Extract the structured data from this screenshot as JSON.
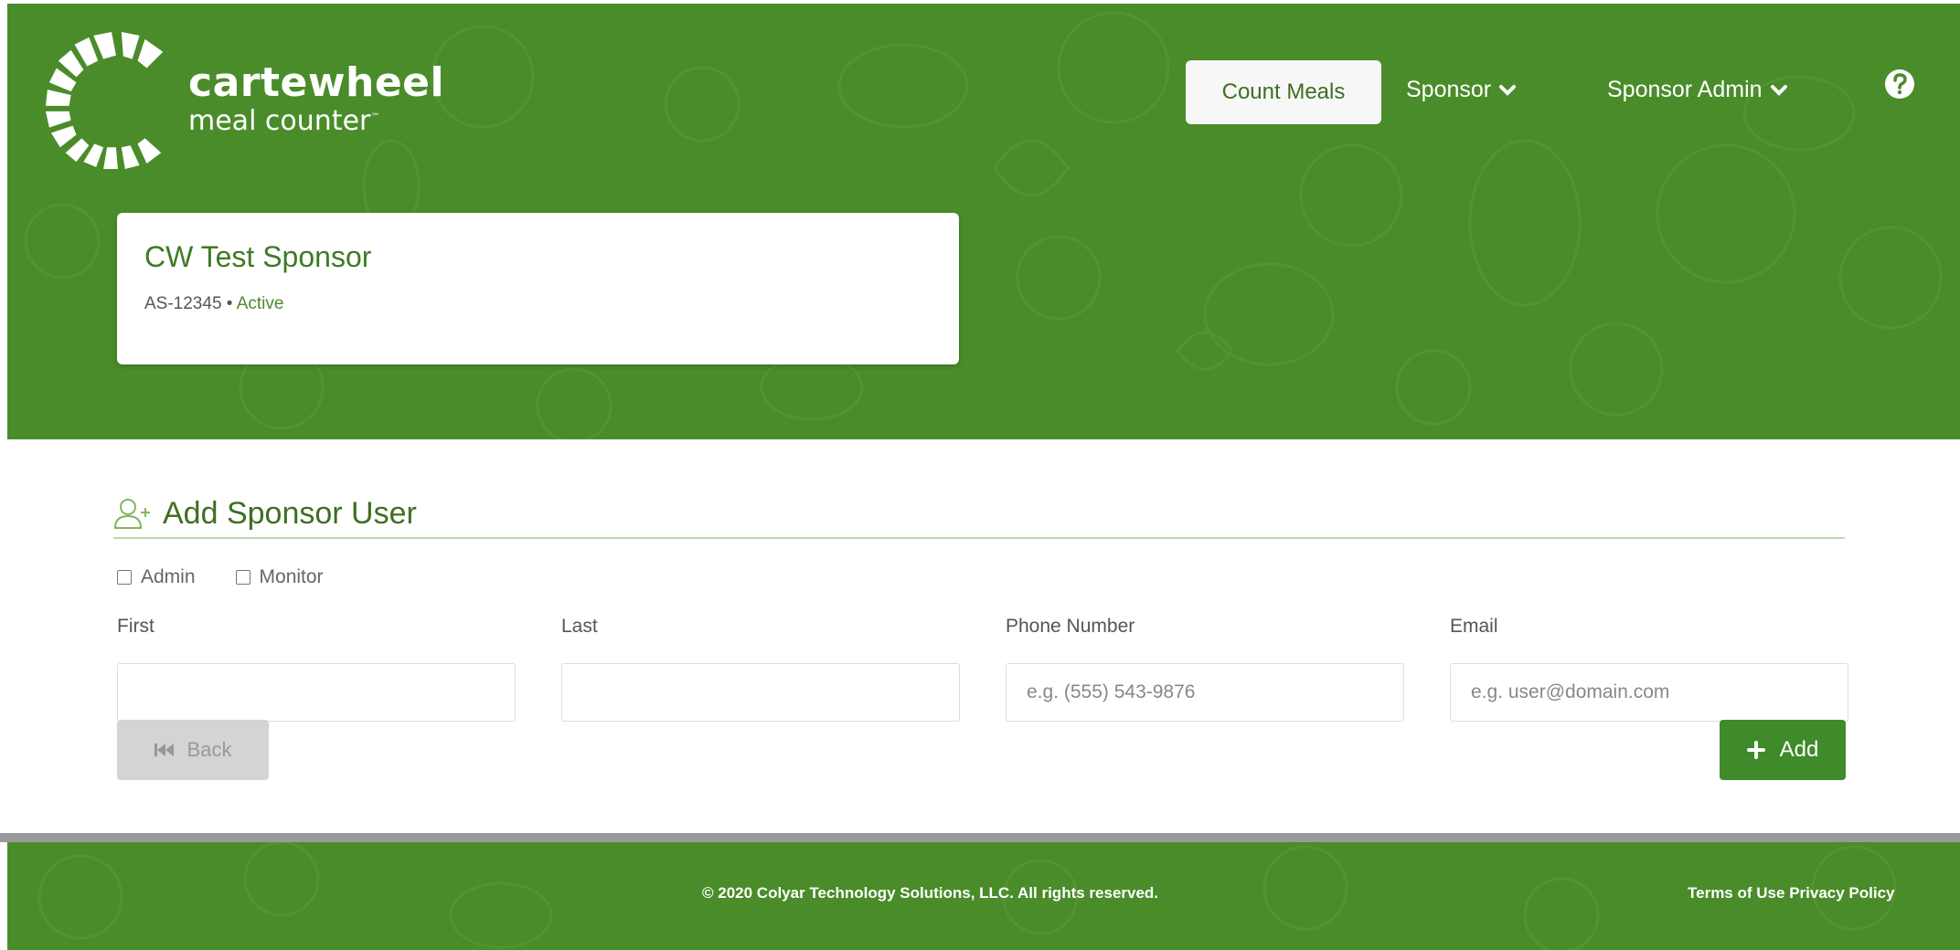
{
  "brand": {
    "name": "cartewheel",
    "tagline": "meal counter",
    "tm": "™",
    "primary_color": "#4a8c2a"
  },
  "nav": {
    "count_meals": "Count Meals",
    "sponsor": "Sponsor",
    "sponsor_admin": "Sponsor Admin",
    "help_icon": "question-circle-icon"
  },
  "sponsor": {
    "name": "CW Test Sponsor",
    "code": "AS-12345",
    "separator": " • ",
    "status": "Active"
  },
  "form": {
    "title": "Add Sponsor User",
    "title_icon": "add-user-icon",
    "checkboxes": {
      "admin": "Admin",
      "monitor": "Monitor"
    },
    "fields": {
      "first": {
        "label": "First",
        "value": "",
        "placeholder": ""
      },
      "last": {
        "label": "Last",
        "value": "",
        "placeholder": ""
      },
      "phone": {
        "label": "Phone Number",
        "value": "",
        "placeholder": "e.g. (555) 543-9876"
      },
      "email": {
        "label": "Email",
        "value": "",
        "placeholder": "e.g. user@domain.com"
      }
    },
    "back_label": "Back",
    "add_label": "Add"
  },
  "footer": {
    "copyright": "© 2020 Colyar Technology Solutions, LLC. All rights reserved.",
    "terms": "Terms of Use",
    "privacy": "Privacy Policy"
  }
}
